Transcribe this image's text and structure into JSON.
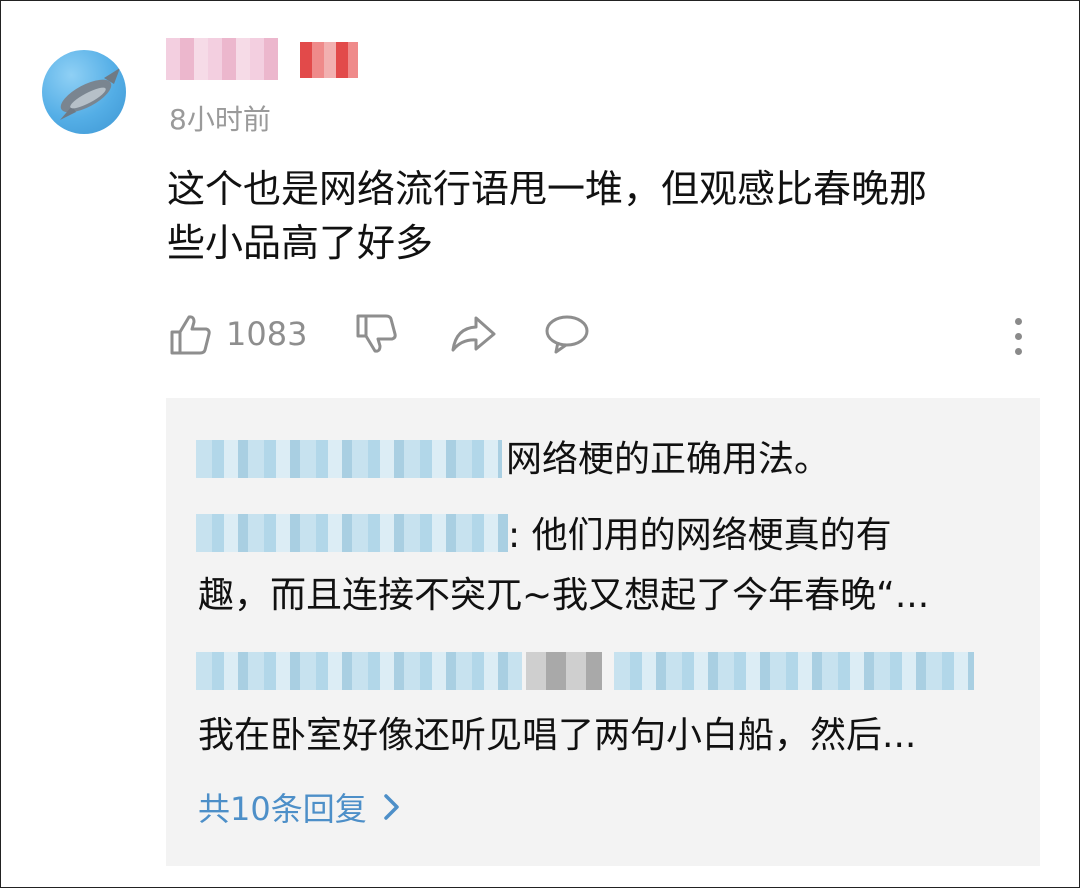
{
  "comment": {
    "author_name": "",
    "timestamp": "8小时前",
    "text_line1": "这个也是网络流行语甩一堆，但观感比春晚那",
    "text_line2": "些小品高了好多",
    "like_count": "1083"
  },
  "replies": {
    "items": [
      {
        "text": "网络梗的正确用法。"
      },
      {
        "text_line1": ": 他们用的网络梗真的有",
        "text_line2": "趣，而且连接不突兀~我又想起了今年春晚“..."
      },
      {
        "text": "我在卧室好像还听见唱了两句小白船，然后..."
      }
    ],
    "view_more_label": "共10条回复"
  },
  "colors": {
    "timestamp": "#9a9a9a",
    "link_blue": "#4d8fc8",
    "reply_bg": "#f3f3f3",
    "icon_gray": "#8e8e8e"
  },
  "icons": [
    "thumbs-up-icon",
    "thumbs-down-icon",
    "share-icon",
    "comment-icon",
    "more-vertical-icon",
    "chevron-right-icon"
  ]
}
